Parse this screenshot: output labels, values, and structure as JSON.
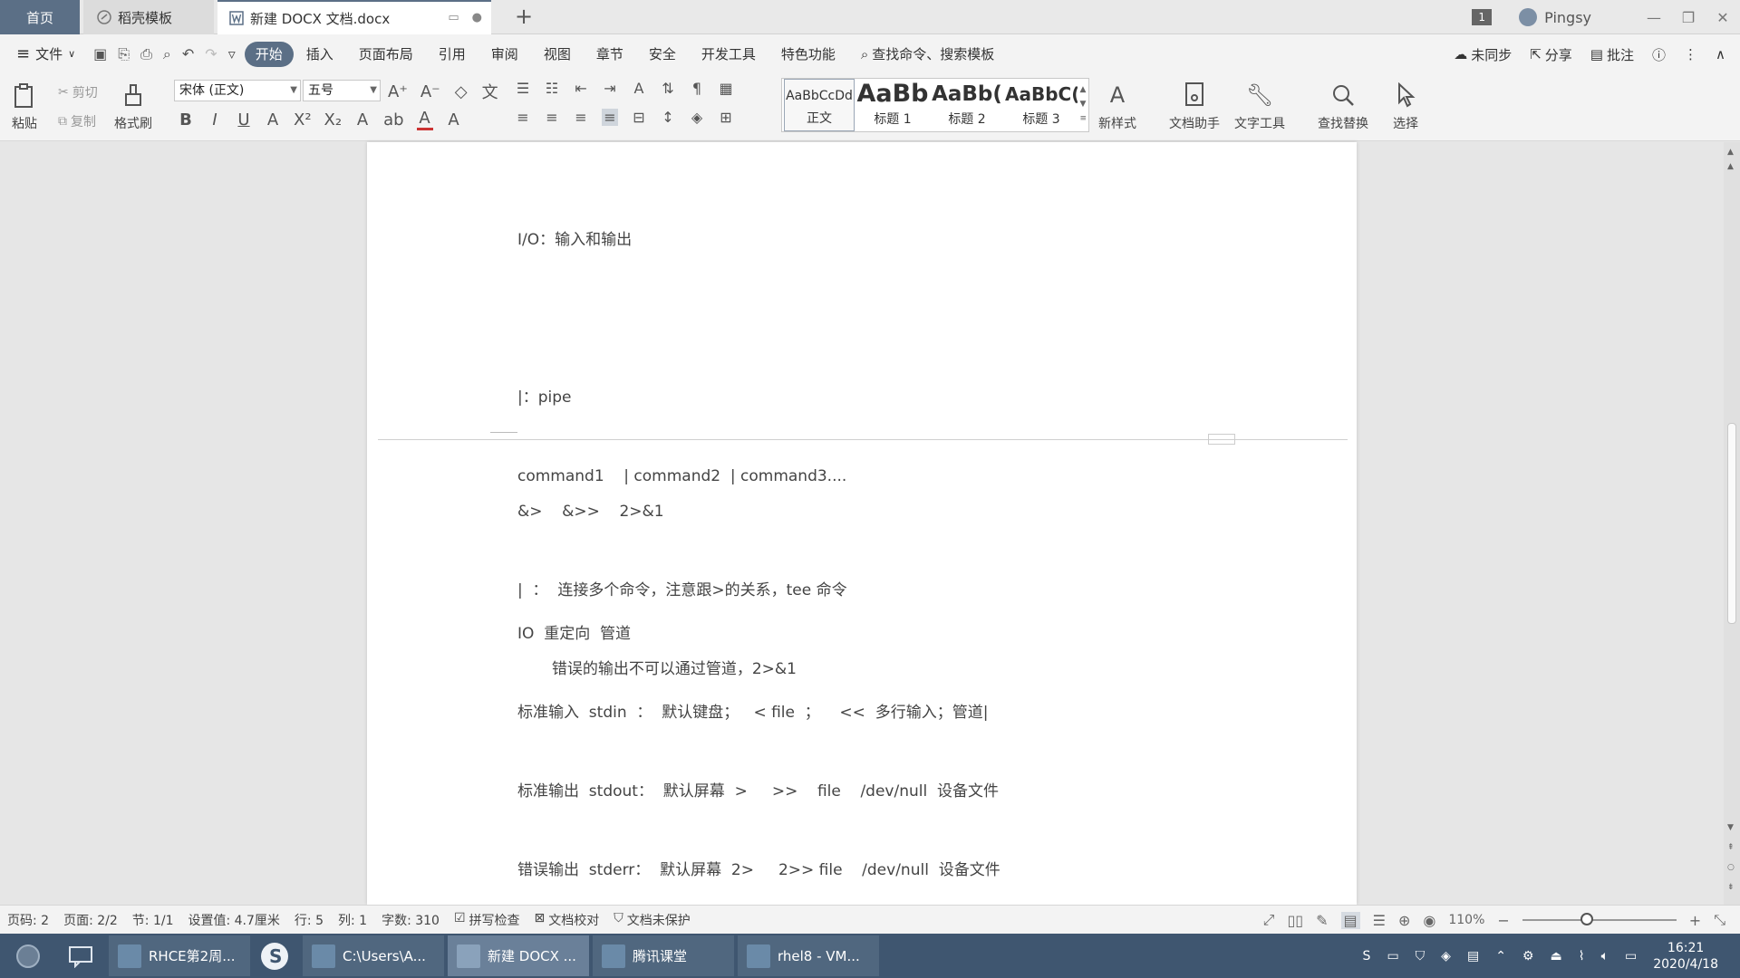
{
  "tabs": {
    "home": "首页",
    "template": "稻壳模板",
    "document": "新建 DOCX 文档.docx"
  },
  "titlebar": {
    "badge": "1",
    "user": "Pingsy"
  },
  "menu": {
    "file": "文件",
    "items": [
      "开始",
      "插入",
      "页面布局",
      "引用",
      "审阅",
      "视图",
      "章节",
      "安全",
      "开发工具",
      "特色功能"
    ],
    "search": "查找命令、搜索模板",
    "sync": "未同步",
    "share": "分享",
    "comment": "批注"
  },
  "ribbon": {
    "paste": "粘贴",
    "cut": "剪切",
    "copy": "复制",
    "format_painter": "格式刷",
    "font_name": "宋体 (正文)",
    "font_size": "五号",
    "styles": [
      {
        "preview": "AaBbCcDd",
        "name": "正文"
      },
      {
        "preview": "AaBb",
        "name": "标题 1"
      },
      {
        "preview": "AaBb(",
        "name": "标题 2"
      },
      {
        "preview": "AaBbC(",
        "name": "标题 3"
      }
    ],
    "new_style": "新样式",
    "doc_assistant": "文档助手",
    "text_tools": "文字工具",
    "find_replace": "查找替换",
    "select": "选择"
  },
  "document": {
    "lines_page1": [
      "I/O：输入和输出",
      "",
      "|：pipe",
      "command1    | command2  | command3....",
      "",
      "IO  重定向  管道",
      "标准输入  stdin  ：  默认键盘；   < file  ；    <<  多行输入；管道|",
      "标准输出  stdout：  默认屏幕  >     >>    file    /dev/null  设备文件",
      "错误输出  stderr：  默认屏幕  2>     2>> file    /dev/null  设备文件"
    ],
    "lines_page2": [
      "&>    &>>    2>&1",
      "|  ：  连接多个命令，注意跟>的关系，tee 命令",
      "       错误的输出不可以通过管道，2>&1"
    ]
  },
  "status": {
    "page": "页码: 2",
    "pages": "页面: 2/2",
    "section": "节: 1/1",
    "setting": "设置值: 4.7厘米",
    "row": "行: 5",
    "col": "列: 1",
    "words": "字数: 310",
    "spell": "拼写检查",
    "proof": "文档校对",
    "protect": "文档未保护",
    "zoom": "110%",
    "zoom_fraction": 0.42
  },
  "taskbar": {
    "apps": [
      "RHCE第2周...",
      "C:\\Users\\A...",
      "新建 DOCX ...",
      "腾讯课堂",
      "rhel8 - VM..."
    ],
    "time": "16:21",
    "date": "2020/4/18"
  }
}
